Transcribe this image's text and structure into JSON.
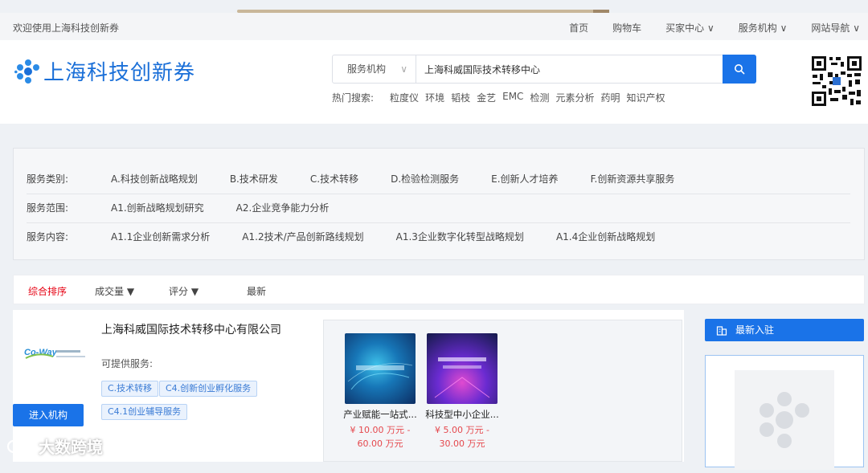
{
  "topbar": {
    "welcome": "欢迎使用上海科技创新券",
    "nav": [
      {
        "label": "首页"
      },
      {
        "label": "购物车"
      },
      {
        "label": "买家中心 ∨"
      },
      {
        "label": "服务机构 ∨"
      },
      {
        "label": "网站导航 ∨"
      }
    ]
  },
  "header": {
    "site_title": "上海科技创新券",
    "search": {
      "category": "服务机构",
      "value": "上海科威国际技术转移中心"
    },
    "hot_label": "热门搜索:",
    "hot_keywords": [
      "粒度仪",
      "环境",
      "韬枝",
      "金艺",
      "EMC",
      "检测",
      "元素分析",
      "药明",
      "知识产权"
    ]
  },
  "filters": {
    "rows": [
      {
        "label": "服务类别:",
        "options": [
          "A.科技创新战略规划",
          "B.技术研发",
          "C.技术转移",
          "D.检验检测服务",
          "E.创新人才培养",
          "F.创新资源共享服务"
        ]
      },
      {
        "label": "服务范围:",
        "options": [
          "A1.创新战略规划研究",
          "A2.企业竞争能力分析"
        ]
      },
      {
        "label": "服务内容:",
        "options": [
          "A1.1企业创新需求分析",
          "A1.2技术/产品创新路线规划",
          "A1.3企业数字化转型战略规划",
          "A1.4企业创新战略规划"
        ]
      }
    ]
  },
  "sort": {
    "options": [
      "综合排序",
      "成交量 ▼",
      "评分 ▼",
      "最新"
    ]
  },
  "company": {
    "name": "上海科威国际技术转移中心有限公司",
    "provide_label": "可提供服务:",
    "tags": [
      "C.技术转移",
      "C4.创新创业孵化服务",
      "C4.1创业辅导服务"
    ],
    "enter_label": "进入机构",
    "products": [
      {
        "name": "产业赋能一站式...",
        "price_line1": "¥ 10.00 万元 -",
        "price_line2": "60.00 万元"
      },
      {
        "name": "科技型中小企业...",
        "price_line1": "¥ 5.00 万元 -",
        "price_line2": "30.00 万元"
      }
    ]
  },
  "sidebar": {
    "new_label": "最新入驻"
  },
  "watermark": "大数跨境",
  "colors": {
    "accent": "#1a73e8",
    "sort_active": "#e60012",
    "price": "#e5484d"
  }
}
